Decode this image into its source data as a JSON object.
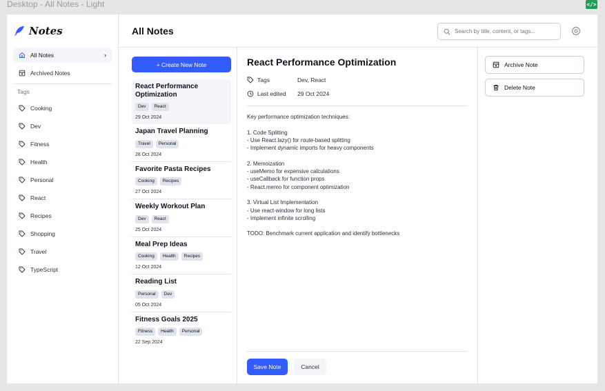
{
  "frame": {
    "label": "Desktop - All Notes - Light",
    "badge": "</>"
  },
  "logo": {
    "text": "Notes",
    "color": "#335cff"
  },
  "nav": [
    {
      "label": "All Notes",
      "icon": "home-icon",
      "active": true
    },
    {
      "label": "Archived Notes",
      "icon": "archive-icon",
      "active": false
    }
  ],
  "tags_heading": "Tags",
  "tags": [
    "Cooking",
    "Dev",
    "Fitness",
    "Health",
    "Personal",
    "React",
    "Recipes",
    "Shopping",
    "Travel",
    "TypeScript"
  ],
  "header": {
    "title": "All Notes",
    "search_placeholder": "Search by title, content, or tags..."
  },
  "create_button": "+ Create New Note",
  "notes": [
    {
      "title": "React Performance Optimization",
      "tags": [
        "Dev",
        "React"
      ],
      "date": "29 Oct 2024",
      "selected": true
    },
    {
      "title": "Japan Travel Planning",
      "tags": [
        "Travel",
        "Personal"
      ],
      "date": "28 Oct 2024"
    },
    {
      "title": "Favorite Pasta Recipes",
      "tags": [
        "Cooking",
        "Recipes"
      ],
      "date": "27 Oct 2024"
    },
    {
      "title": "Weekly Workout Plan",
      "tags": [
        "Dev",
        "React"
      ],
      "date": "25 Oct 2024"
    },
    {
      "title": "Meal Prep Ideas",
      "tags": [
        "Cooking",
        "Health",
        "Recipes"
      ],
      "date": "12 Oct 2024"
    },
    {
      "title": "Reading List",
      "tags": [
        "Personal",
        "Dev"
      ],
      "date": "05 Oct 2024"
    },
    {
      "title": "Fitness Goals 2025",
      "tags": [
        "Fitness",
        "Health",
        "Personal"
      ],
      "date": "22 Sep 2024"
    }
  ],
  "editor": {
    "title": "React Performance Optimization",
    "tags_label": "Tags",
    "tags_value": "Dev, React",
    "edited_label": "Last edited",
    "edited_value": "29 Oct 2024",
    "body": [
      "Key performance optimization techniques:",
      "",
      "1. Code Splitting",
      "- Use React.lazy() for route-based splitting",
      "- Implement dynamic imports for heavy components",
      "",
      "2. Memoization",
      "- useMemo for expensive calculations",
      "- useCallback for function props",
      "- React.memo for component optimization",
      "",
      "3. Virtual List Implementation",
      "- Use react-window for long lists",
      "- Implement infinite scrolling",
      "",
      "TODO: Benchmark current application and identify bottlenecks"
    ],
    "save_label": "Save Note",
    "cancel_label": "Cancel"
  },
  "actions": {
    "archive_label": "Archive Note",
    "delete_label": "Delete Note"
  },
  "colors": {
    "accent": "#335cff",
    "badge": "#1e9e52"
  }
}
